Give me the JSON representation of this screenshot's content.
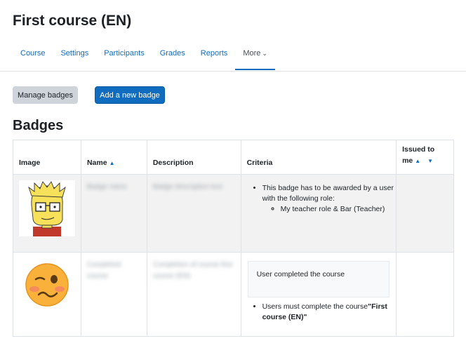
{
  "header": {
    "title": "First course (EN)"
  },
  "secondary_nav": {
    "tabs": [
      "Course",
      "Settings",
      "Participants",
      "Grades",
      "Reports"
    ],
    "more_label": "More"
  },
  "actions": {
    "manage_badges": "Manage badges",
    "add_badge": "Add a new badge"
  },
  "section": {
    "heading": "Badges"
  },
  "table": {
    "headers": {
      "image": "Image",
      "name": "Name",
      "description": "Description",
      "criteria": "Criteria",
      "issued_line1": "Issued to",
      "issued_line2": "me"
    },
    "rows": [
      {
        "name": "Badge name",
        "description": "Badge description text",
        "criteria_item": "This badge has to be awarded by a user with the following role:",
        "criteria_subitem": "My teacher role & Bar (Teacher)"
      },
      {
        "name": "Completed course",
        "description": "Completion of course first course (EN)",
        "criteria_note": "User completed the course",
        "criteria_prefix": "Users must complete the course",
        "criteria_course": "\"First course (EN)\""
      }
    ]
  },
  "icons": [
    "sort-ascending-icon",
    "sort-descending-icon",
    "chevron-down-icon"
  ],
  "colors": {
    "primary": "#0f6cbf",
    "secondary_bg": "#ced4da",
    "row_stripe": "#f2f2f2"
  }
}
